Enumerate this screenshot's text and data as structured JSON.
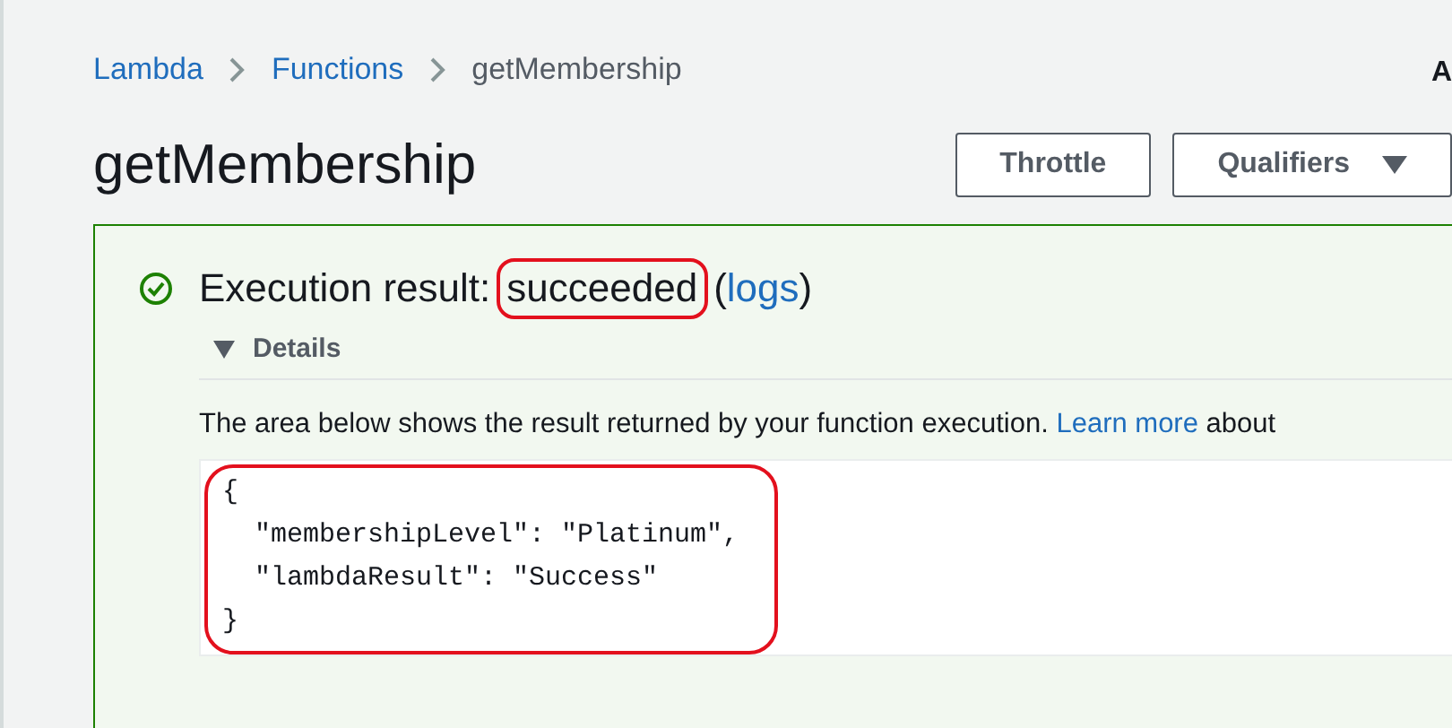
{
  "breadcrumb": [
    {
      "label": "Lambda",
      "link": true
    },
    {
      "label": "Functions",
      "link": true
    },
    {
      "label": "getMembership",
      "link": false
    }
  ],
  "corner_text": "A",
  "title": "getMembership",
  "buttons": [
    {
      "label": "Throttle",
      "dropdown": false
    },
    {
      "label": "Qualifiers",
      "dropdown": true
    }
  ],
  "result": {
    "status": "succeeded",
    "prefix": "Execution result:",
    "status_circled": true,
    "logs_link": "logs",
    "open_paren": "(",
    "close_paren": ")",
    "details": {
      "label": "Details",
      "expanded": true
    },
    "description": "The area below shows the result returned by your function execution.",
    "learn_more": "Learn more",
    "description_tail": "about",
    "code_lines": [
      "{",
      "  \"membershipLevel\": \"Platinum\",",
      "  \"lambdaResult\": \"Success\"",
      "}"
    ],
    "code_circled": true
  }
}
